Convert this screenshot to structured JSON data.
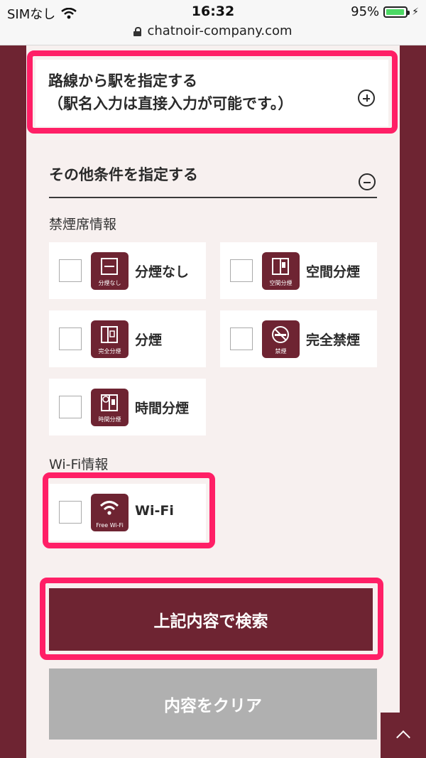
{
  "status": {
    "carrier": "SIMなし",
    "time": "16:32",
    "battery": "95%",
    "battery_fraction": 0.95
  },
  "browser": {
    "url": "chatnoir-company.com"
  },
  "route": {
    "title": "路線から駅を指定する\n（駅名入力は直接入力が可能です。）"
  },
  "other": {
    "title": "その他条件を指定する"
  },
  "smoking": {
    "label": "禁煙席情報",
    "options": [
      {
        "label": "分煙なし",
        "icon_sub": "分煙なし"
      },
      {
        "label": "空間分煙",
        "icon_sub": "空間分煙"
      },
      {
        "label": "分煙",
        "icon_sub": "完全分煙"
      },
      {
        "label": "完全禁煙",
        "icon_sub": "禁煙"
      },
      {
        "label": "時間分煙",
        "icon_sub": "時間分煙"
      }
    ]
  },
  "wifi": {
    "label": "Wi-Fi情報",
    "option": {
      "label": "Wi-Fi",
      "icon_sub": "Free Wi-Fi"
    }
  },
  "buttons": {
    "search": "上記内容で検索",
    "clear": "内容をクリア"
  },
  "colors": {
    "brand": "#6e2432",
    "highlight": "#ff1f66",
    "panel": "#f7f0ef",
    "clear": "#b0b0b0"
  }
}
